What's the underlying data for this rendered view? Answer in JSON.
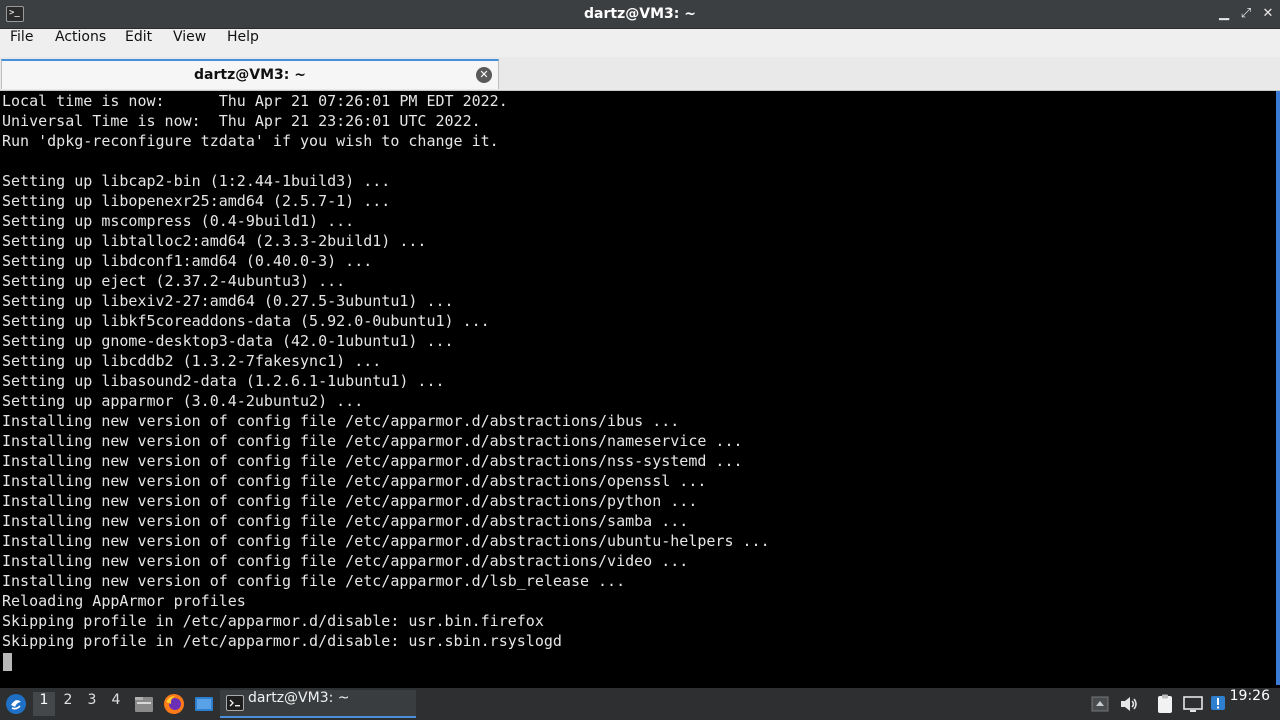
{
  "window": {
    "title": "dartz@VM3: ~",
    "icon_name": "terminal-icon",
    "controls": {
      "minimize": "▁",
      "restore": "⤢",
      "close": "✕"
    }
  },
  "menu": [
    "File",
    "Actions",
    "Edit",
    "View",
    "Help"
  ],
  "tab": {
    "label": "dartz@VM3: ~",
    "close_icon": "✕"
  },
  "terminal": {
    "lines": [
      "Local time is now:      Thu Apr 21 07:26:01 PM EDT 2022.",
      "Universal Time is now:  Thu Apr 21 23:26:01 UTC 2022.",
      "Run 'dpkg-reconfigure tzdata' if you wish to change it.",
      "",
      "Setting up libcap2-bin (1:2.44-1build3) ...",
      "Setting up libopenexr25:amd64 (2.5.7-1) ...",
      "Setting up mscompress (0.4-9build1) ...",
      "Setting up libtalloc2:amd64 (2.3.3-2build1) ...",
      "Setting up libdconf1:amd64 (0.40.0-3) ...",
      "Setting up eject (2.37.2-4ubuntu3) ...",
      "Setting up libexiv2-27:amd64 (0.27.5-3ubuntu1) ...",
      "Setting up libkf5coreaddons-data (5.92.0-0ubuntu1) ...",
      "Setting up gnome-desktop3-data (42.0-1ubuntu1) ...",
      "Setting up libcddb2 (1.3.2-7fakesync1) ...",
      "Setting up libasound2-data (1.2.6.1-1ubuntu1) ...",
      "Setting up apparmor (3.0.4-2ubuntu2) ...",
      "Installing new version of config file /etc/apparmor.d/abstractions/ibus ...",
      "Installing new version of config file /etc/apparmor.d/abstractions/nameservice ...",
      "Installing new version of config file /etc/apparmor.d/abstractions/nss-systemd ...",
      "Installing new version of config file /etc/apparmor.d/abstractions/openssl ...",
      "Installing new version of config file /etc/apparmor.d/abstractions/python ...",
      "Installing new version of config file /etc/apparmor.d/abstractions/samba ...",
      "Installing new version of config file /etc/apparmor.d/abstractions/ubuntu-helpers ...",
      "Installing new version of config file /etc/apparmor.d/abstractions/video ...",
      "Installing new version of config file /etc/apparmor.d/lsb_release ...",
      "Reloading AppArmor profiles",
      "Skipping profile in /etc/apparmor.d/disable: usr.bin.firefox",
      "Skipping profile in /etc/apparmor.d/disable: usr.sbin.rsyslogd"
    ]
  },
  "taskbar": {
    "start_icon": "lubuntu-start-icon",
    "workspaces": [
      "1",
      "2",
      "3",
      "4"
    ],
    "active_workspace": "1",
    "launchers": [
      "file-manager-icon",
      "firefox-icon",
      "desktop-icon"
    ],
    "task": {
      "label": "dartz@VM3: ~",
      "icon": "terminal-icon"
    },
    "tray": [
      "tray-up-arrow-icon",
      "volume-icon",
      "clipboard-icon",
      "network-icon",
      "update-notifier-icon"
    ],
    "clock": "19:26"
  },
  "colors": {
    "accent": "#4a90d9",
    "terminal_bg": "#000000",
    "terminal_fg": "#e6e6e6",
    "panel": "#2d2f31"
  }
}
